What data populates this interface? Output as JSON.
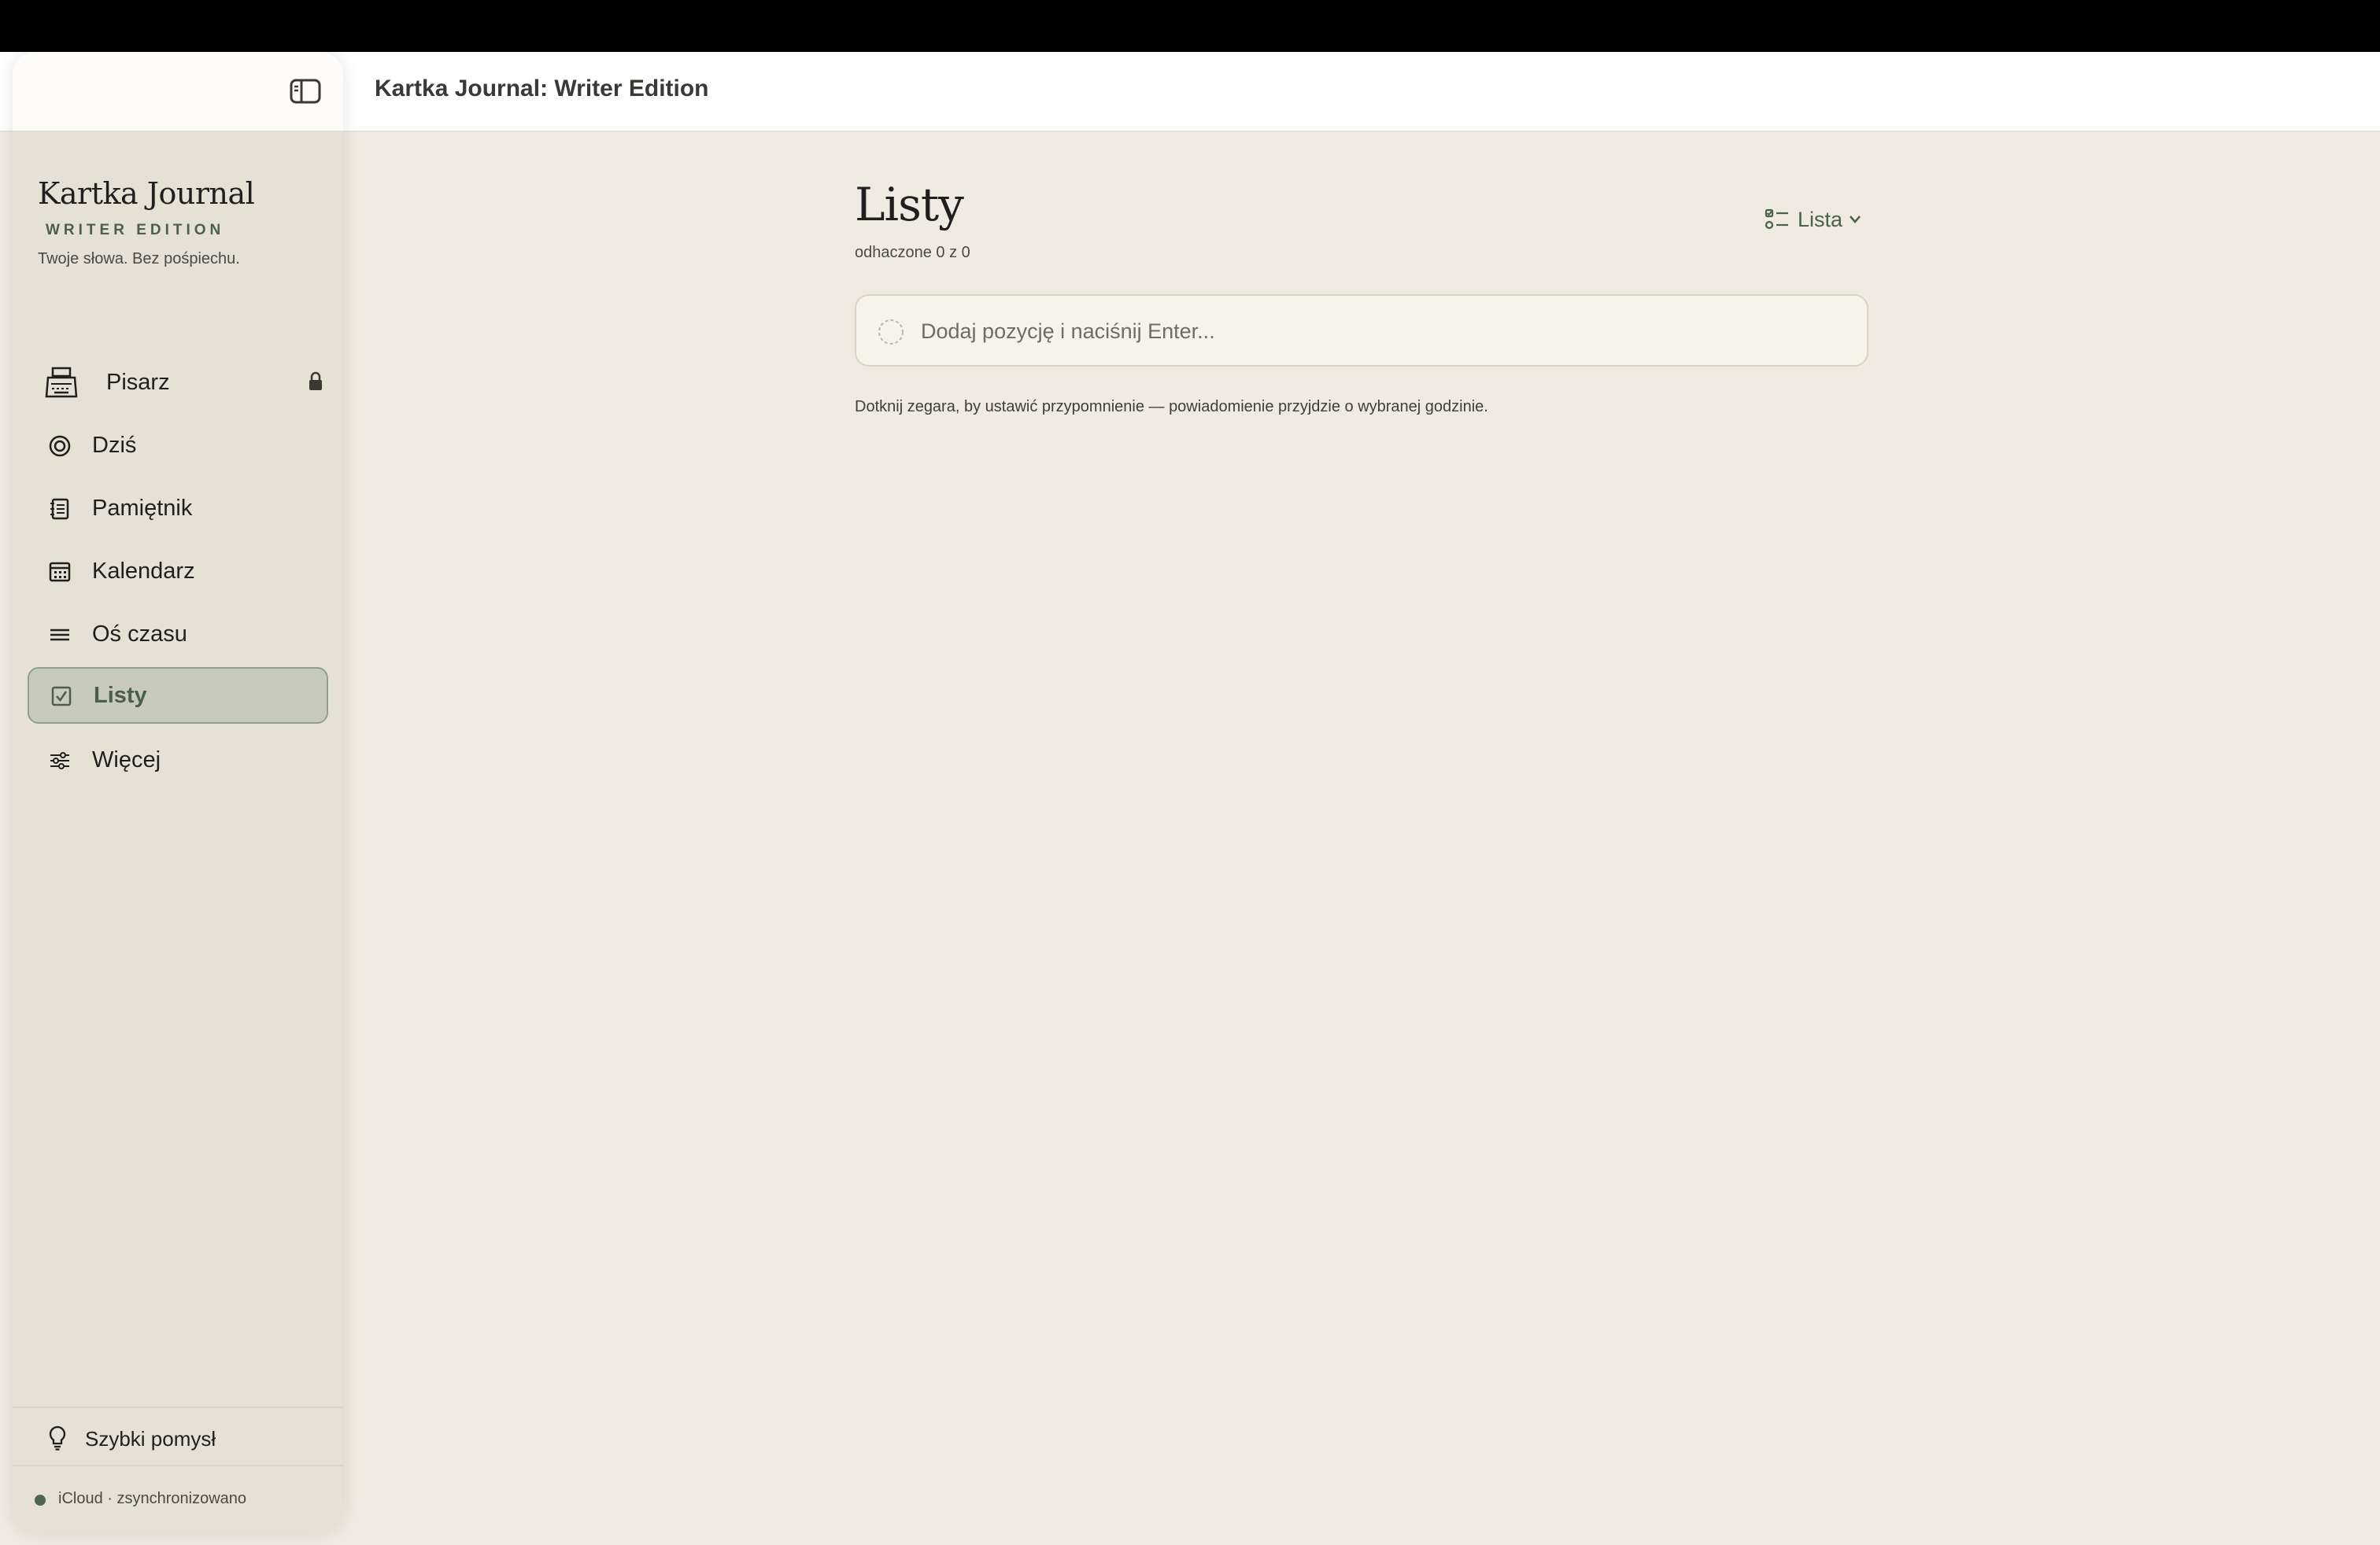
{
  "window": {
    "title": "Kartka Journal: Writer Edition"
  },
  "sidebar": {
    "brand": {
      "title": "Kartka Journal",
      "edition": "WRITER EDITION",
      "tagline": "Twoje słowa. Bez pośpiechu."
    },
    "items": [
      {
        "label": "Pisarz",
        "icon": "typewriter-icon",
        "locked": true
      },
      {
        "label": "Dziś",
        "icon": "target-icon"
      },
      {
        "label": "Pamiętnik",
        "icon": "notebook-icon"
      },
      {
        "label": "Kalendarz",
        "icon": "calendar-icon"
      },
      {
        "label": "Oś czasu",
        "icon": "timeline-icon"
      },
      {
        "label": "Listy",
        "icon": "checklist-icon",
        "active": true
      },
      {
        "label": "Więcej",
        "icon": "sliders-icon"
      }
    ],
    "quick_idea": {
      "label": "Szybki pomysł",
      "icon": "lightbulb-icon"
    },
    "sync": {
      "label": "iCloud · zsynchronizowano"
    }
  },
  "main": {
    "title": "Listy",
    "subtitle": "odhaczone 0 z 0",
    "view_switch": {
      "label": "Lista",
      "icon": "list-view-icon"
    },
    "add_item": {
      "placeholder": "Dodaj pozycję i naciśnij Enter...",
      "value": ""
    },
    "hint": "Dotknij zegara, by ustawić przypomnienie — powiadomienie przyjdzie o wybranej godzinie."
  },
  "colors": {
    "background": "#efebe0",
    "sidebar": "#e5e1d4",
    "accent": "#4a6048",
    "active_item": "#c8cbbc"
  }
}
